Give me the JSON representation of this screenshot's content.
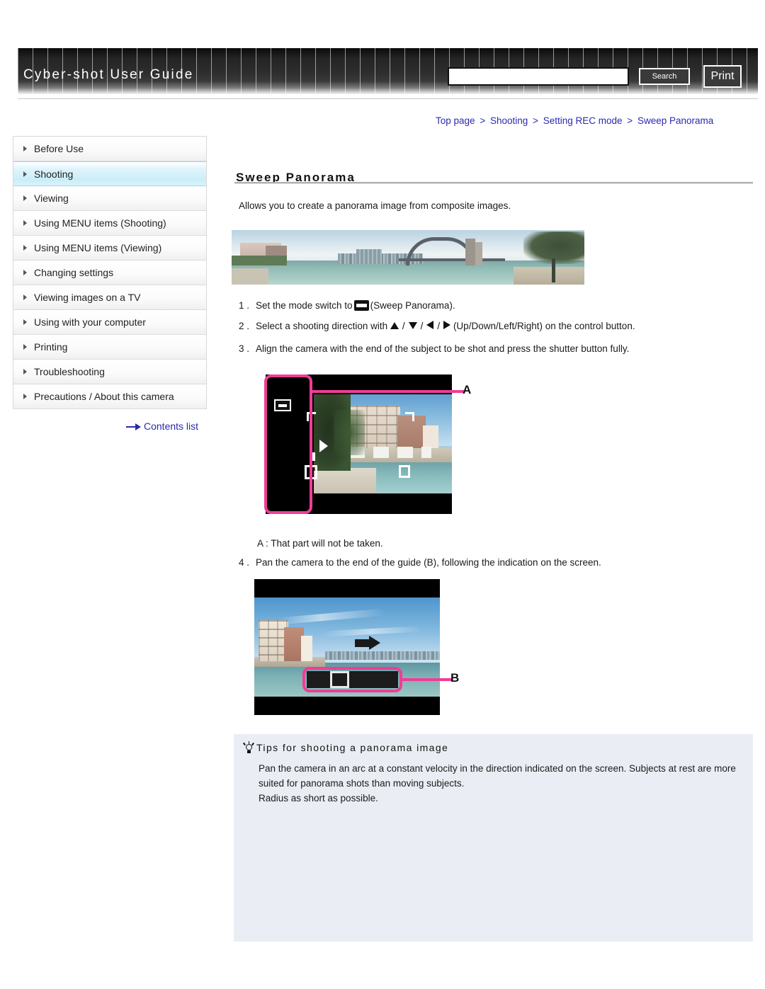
{
  "header": {
    "site_title": "Cyber-shot User Guide",
    "search_placeholder": "",
    "search_value": "",
    "search_label": "Search",
    "print_label": "Print"
  },
  "breadcrumb": {
    "items": [
      "Top page",
      "Shooting",
      "Setting REC mode",
      "Sweep Panorama"
    ],
    "separator": ">"
  },
  "sidebar": {
    "items": [
      {
        "label": "Before Use"
      },
      {
        "label": "Shooting"
      },
      {
        "label": "Viewing"
      },
      {
        "label": "Using MENU items (Shooting)"
      },
      {
        "label": "Using MENU items (Viewing)"
      },
      {
        "label": "Changing settings"
      },
      {
        "label": "Viewing images on a TV"
      },
      {
        "label": "Using with your computer"
      },
      {
        "label": "Printing"
      },
      {
        "label": "Troubleshooting"
      },
      {
        "label": "Precautions / About this camera"
      }
    ],
    "active_index": 1,
    "contents_link": "Contents list"
  },
  "main": {
    "title": "Sweep Panorama",
    "intro": "Allows you to create a panorama image from composite images.",
    "steps": {
      "step1_num": "1 .",
      "step1_a": "Set the mode switch to",
      "step1_b": "(Sweep Panorama).",
      "step2_num": "2 .",
      "step2_a": "Select a shooting direction with",
      "step2_b": "(Up/Down/Left/Right) on the control button.",
      "step3_num": "3 .",
      "step3_text": "Align the camera with the end of the subject to be shot and press the shutter button fully.",
      "step4_num": "4 .",
      "step4_text": "Pan the camera to the end of the guide (B), following the indication on the screen."
    },
    "note_a": "A : That part will not be taken.",
    "figure_a_label": "A",
    "figure_b_label": "B"
  },
  "tips": {
    "heading": "Tips for shooting a panorama image",
    "line1": "Pan the camera in an arc at a constant velocity in the direction indicated on the screen. Subjects at rest are more suited for panorama shots than moving subjects.",
    "line2": "Radius as short as possible."
  },
  "colors": {
    "link": "#2a2ab0",
    "highlight_pink": "#ef3d96",
    "sidebar_active": "#c9eef9",
    "tips_bg": "#eaeef4"
  }
}
